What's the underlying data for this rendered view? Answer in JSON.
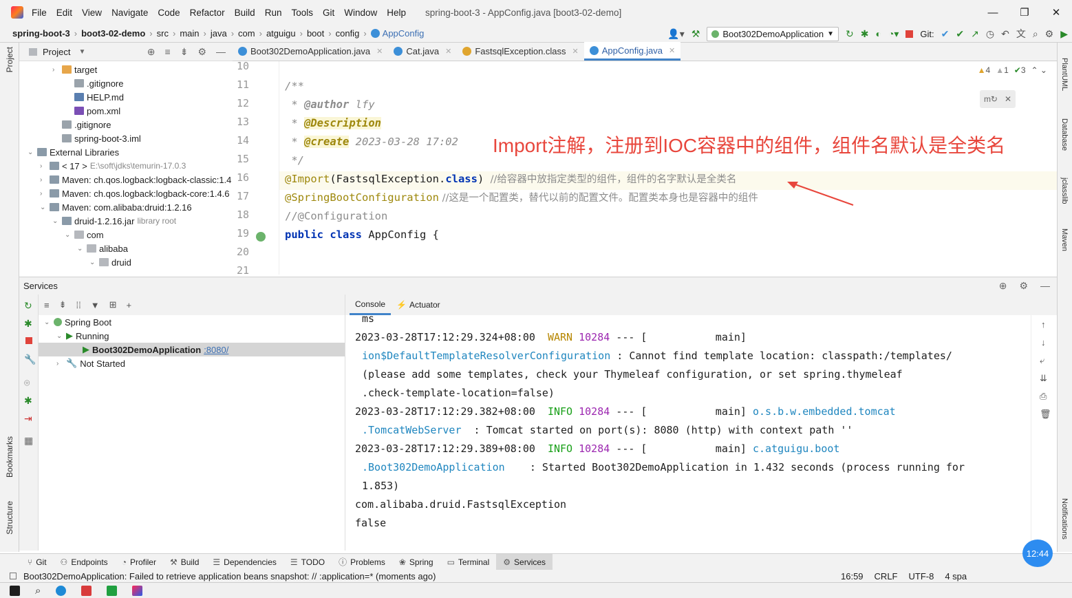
{
  "titlebar": {
    "menu": [
      "File",
      "Edit",
      "View",
      "Navigate",
      "Code",
      "Refactor",
      "Build",
      "Run",
      "Tools",
      "Git",
      "Window",
      "Help"
    ],
    "title": "spring-boot-3 - AppConfig.java [boot3-02-demo]",
    "minimize": "—",
    "restore": "❐",
    "close": "✕"
  },
  "breadcrumb": [
    "spring-boot-3",
    "boot3-02-demo",
    "src",
    "main",
    "java",
    "com",
    "atguigu",
    "boot",
    "config",
    "AppConfig"
  ],
  "toolbar": {
    "run_config": "Boot302DemoApplication",
    "git_label": "Git:"
  },
  "project": {
    "header": "Project",
    "tree": [
      {
        "label": "target",
        "indent": 3,
        "arrow": "›",
        "icon": "folder-orange"
      },
      {
        "label": ".gitignore",
        "indent": 4,
        "arrow": "",
        "icon": "file"
      },
      {
        "label": "HELP.md",
        "indent": 4,
        "arrow": "",
        "icon": "md"
      },
      {
        "label": "pom.xml",
        "indent": 4,
        "arrow": "",
        "icon": "maven"
      },
      {
        "label": ".gitignore",
        "indent": 3,
        "arrow": "",
        "icon": "file"
      },
      {
        "label": "spring-boot-3.iml",
        "indent": 3,
        "arrow": "",
        "icon": "file"
      },
      {
        "label": "External Libraries",
        "indent": 1,
        "arrow": "⌄",
        "icon": "lib"
      },
      {
        "label": "< 17 >",
        "extra": "E:\\soft\\jdks\\temurin-17.0.3",
        "indent": 2,
        "arrow": "›",
        "icon": "lib"
      },
      {
        "label": "Maven: ch.qos.logback:logback-classic:1.4",
        "indent": 2,
        "arrow": "›",
        "icon": "lib"
      },
      {
        "label": "Maven: ch.qos.logback:logback-core:1.4.6",
        "indent": 2,
        "arrow": "›",
        "icon": "lib"
      },
      {
        "label": "Maven: com.alibaba:druid:1.2.16",
        "indent": 2,
        "arrow": "⌄",
        "icon": "lib"
      },
      {
        "label": "druid-1.2.16.jar",
        "extra": "library root",
        "indent": 3,
        "arrow": "⌄",
        "icon": "jar"
      },
      {
        "label": "com",
        "indent": 4,
        "arrow": "⌄",
        "icon": "folder"
      },
      {
        "label": "alibaba",
        "indent": 5,
        "arrow": "⌄",
        "icon": "folder"
      },
      {
        "label": "druid",
        "indent": 6,
        "arrow": "⌄",
        "icon": "folder"
      }
    ]
  },
  "tabs": [
    {
      "label": "Boot302DemoApplication.java",
      "color": "#3c8fd8",
      "active": false
    },
    {
      "label": "Cat.java",
      "color": "#3c8fd8",
      "active": false
    },
    {
      "label": "FastsqlException.class",
      "color": "#e0a52e",
      "active": false
    },
    {
      "label": "AppConfig.java",
      "color": "#3c8fd8",
      "active": true
    }
  ],
  "editor": {
    "inspections": {
      "warnings": "4",
      "weak": "1",
      "ok": "3"
    },
    "line_numbers": [
      "10",
      "11",
      "12",
      "13",
      "14",
      "15",
      "16",
      "17",
      "18",
      "19",
      "20",
      "21"
    ],
    "line11": "/**",
    "line12_star": " * ",
    "line12_tag": "@author",
    "line12_val": " lfy",
    "line13_star": " * ",
    "line13_tag": "@Description",
    "line14_star": " * ",
    "line14_tag": "@create",
    "line14_val": " 2023-03-28 17:02",
    "line15": " */",
    "line16_ann": "@Import",
    "line16_body": "(FastsqlException.",
    "line16_kw": "class",
    "line16_end": ") ",
    "line16_cm": "//给容器中放指定类型的组件，组件的名字默认是全类名",
    "line17_ann": "@SpringBootConfiguration",
    "line17_cm": " //这是一个配置类，替代以前的配置文件。配置类本身也是容器中的组件",
    "line18_cm": "//@Configuration",
    "line19_kw1": "public",
    "line19_kw2": "class",
    "line19_rest": " AppConfig {",
    "annotation_text": "Import注解，注册到IOC容器中的组件，组件名默认是全类名"
  },
  "services": {
    "title": "Services",
    "tree": [
      {
        "label": "Spring Boot",
        "indent": 0
      },
      {
        "label": "Running",
        "indent": 1
      },
      {
        "label": "Boot302DemoApplication",
        "port": ":8080/",
        "indent": 2
      },
      {
        "label": "Not Started",
        "indent": 1
      }
    ],
    "console_tabs": [
      "Console",
      "Actuator"
    ]
  },
  "console": {
    "l0": "ms",
    "l1_time": "2023-03-28T17:12:29.324+08:00  ",
    "l1_level": "WARN",
    "l1_pid": " 10284",
    "l1_rest": " --- [           main]",
    "l2_cls": "ion$DefaultTemplateResolverConfiguration",
    "l2_rest": " : Cannot find template location: classpath:/templates/",
    "l3": "(please add some templates, check your Thymeleaf configuration, or set spring.thymeleaf",
    "l4": ".check-template-location=false)",
    "l5_time": "2023-03-28T17:12:29.382+08:00  ",
    "l5_level": "INFO",
    "l5_pid": " 10284",
    "l5_rest": " --- [           main] ",
    "l5_cls": "o.s.b.w.embedded.tomcat",
    "l6_cls": ".TomcatWebServer",
    "l6_rest": "  : Tomcat started on port(s): 8080 (http) with context path ''",
    "l7_time": "2023-03-28T17:12:29.389+08:00  ",
    "l7_level": "INFO",
    "l7_pid": " 10284",
    "l7_rest": " --- [           main] ",
    "l7_cls": "c.atguigu.boot",
    "l8_cls": ".Boot302DemoApplication",
    "l8_rest": "    : Started Boot302DemoApplication in 1.432 seconds (process running for",
    "l9": "1.853)",
    "l10": "com.alibaba.druid.FastsqlException",
    "l11": "false"
  },
  "bottom_tabs": [
    "Git",
    "Endpoints",
    "Profiler",
    "Build",
    "Dependencies",
    "TODO",
    "Problems",
    "Spring",
    "Terminal",
    "Services"
  ],
  "status": {
    "message": "Boot302DemoApplication: Failed to retrieve application beans snapshot: // :application=* (moments ago)",
    "position": "16:59",
    "line_sep": "CRLF",
    "encoding": "UTF-8",
    "indent": "4 spa"
  },
  "side_labels": {
    "project": "Project",
    "bookmarks": "Bookmarks",
    "structure": "Structure",
    "plantuml": "PlantUML",
    "database": "Database",
    "jclasslib": "jclasslib",
    "maven": "Maven",
    "notifications": "Notifications"
  },
  "clock": "12:44"
}
